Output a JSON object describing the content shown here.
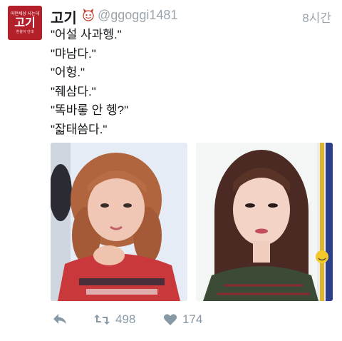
{
  "tweet": {
    "avatar_text_top": "어떤세상 사는데",
    "avatar_text_main": "고기",
    "avatar_text_bottom": "환불이 안대",
    "display_name": "고기",
    "handle": "@ggoggi1481",
    "timestamp": "8시간",
    "lines": [
      "\"어설 사과헹.\"",
      "\"먀남다.\"",
      "\"어헝.\"",
      "\"줴삼다.\"",
      "\"똑바롷 안 헹?\"",
      "\"잛태씀다.\""
    ],
    "retweet_count": "498",
    "like_count": "174"
  },
  "icons": {
    "emoji": "devil-face-icon",
    "reply": "reply-icon",
    "retweet": "retweet-icon",
    "like": "heart-icon"
  },
  "colors": {
    "name": "#14171a",
    "muted": "#9aa5ad",
    "action": "#8899a6",
    "avatar_bg": "#b3202a"
  }
}
